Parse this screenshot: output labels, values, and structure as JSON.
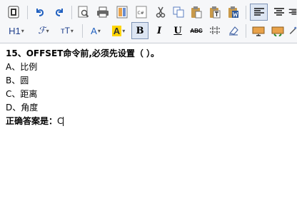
{
  "toolbar": {
    "heading_label": "H1",
    "font_family_label": "ℱ",
    "font_size_label": "тT",
    "font_color_label": "A",
    "highlight_label": "A",
    "bold_label": "B",
    "italic_label": "I",
    "underline_label": "U",
    "strike_label": "ABC",
    "css_label": "C#"
  },
  "editor": {
    "question": "15、OFFSET命令前,必须先设置（ ）。",
    "options": [
      "A、比例",
      "B、圆",
      "C、距离",
      "D、角度"
    ],
    "answer_label": "正确答案是：",
    "answer_value": "C"
  },
  "colors": {
    "toolbar_bg": "#f6f7f9",
    "icon_blue": "#1f5fbf",
    "highlight": "#ffd500"
  }
}
